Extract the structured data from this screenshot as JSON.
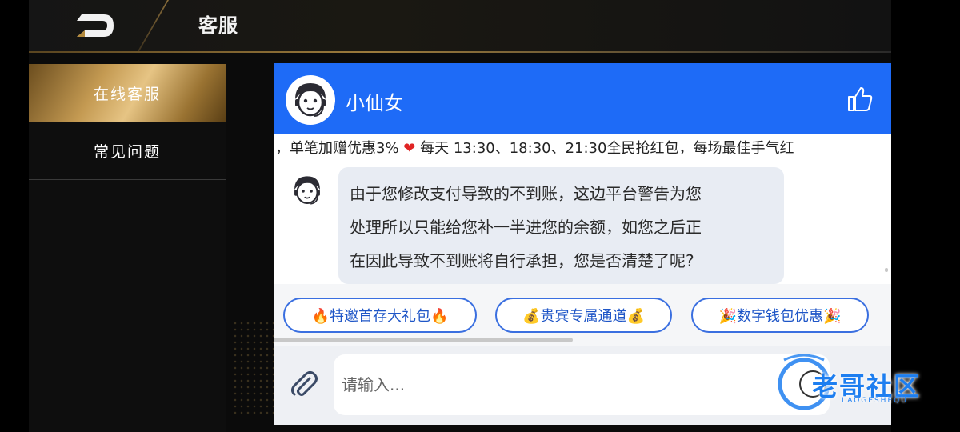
{
  "header": {
    "title": "客服"
  },
  "sidebar": {
    "items": [
      {
        "label": "在线客服",
        "active": true
      },
      {
        "label": "常见问题",
        "active": false
      }
    ]
  },
  "chat": {
    "agent_name": "小仙女",
    "marquee": {
      "part1": "，单笔加赠优惠3%",
      "part2": " 每天 13:30、18:30、21:30全民抢红包，每场最佳手气红"
    },
    "message": {
      "line1": "由于您修改支付导致的不到账，这边平台警告为您",
      "line2": "处理所以只能给您补一半进您的余额，如您之后正",
      "line3": "在因此导致不到账将自行承担，您是否清楚了呢?"
    },
    "quick_replies": [
      "🔥特邀首存大礼包🔥",
      "💰贵宾专属通道💰",
      "🎉数字钱包优惠🎉"
    ],
    "input": {
      "placeholder": "请输入..."
    }
  },
  "watermark": {
    "text": "老哥社区",
    "sub": "LAOGESHEQU"
  },
  "colors": {
    "header_blue": "#1e6bf7",
    "chip_blue": "#1f56c7",
    "gold": "#c49a52",
    "bubble": "#e8ecf3"
  },
  "icons": [
    "back-icon",
    "agent-avatar-icon",
    "thumbs-up-icon",
    "heart-icon",
    "attach-icon",
    "emoji-icon"
  ]
}
